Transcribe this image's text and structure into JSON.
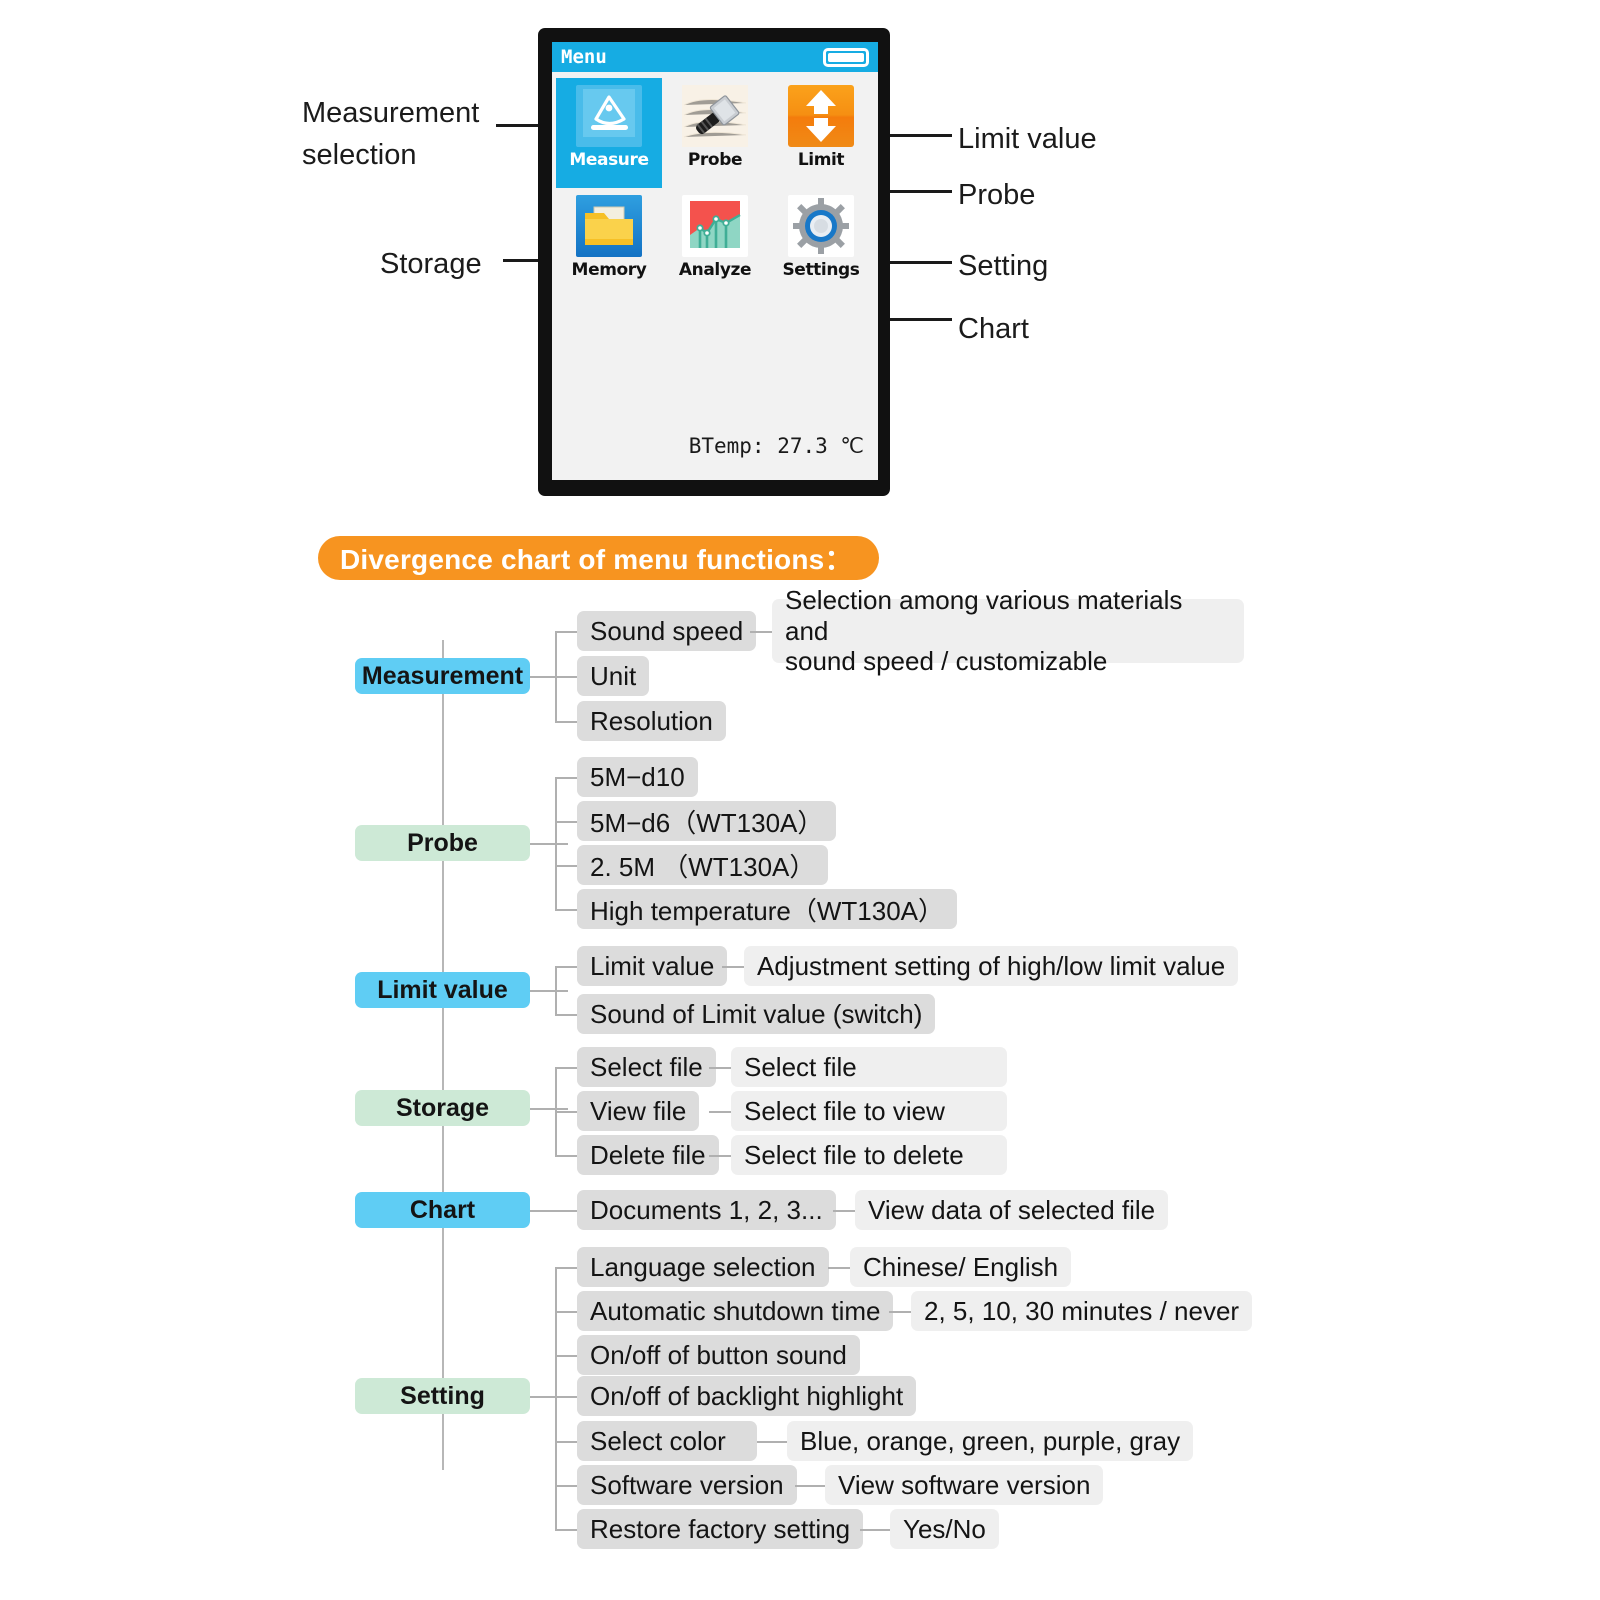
{
  "device": {
    "screen_title": "Menu",
    "battery_icon": "battery-full-icon",
    "status_text": "BTemp: 27.3 ℃",
    "tiles": [
      {
        "label": "Measure",
        "icon": "measure-icon",
        "selected": true
      },
      {
        "label": "Probe",
        "icon": "probe-icon",
        "selected": false
      },
      {
        "label": "Limit",
        "icon": "limit-icon",
        "selected": false
      },
      {
        "label": "Memory",
        "icon": "folder-icon",
        "selected": false
      },
      {
        "label": "Analyze",
        "icon": "chart-icon",
        "selected": false
      },
      {
        "label": "Settings",
        "icon": "gear-icon",
        "selected": false
      }
    ]
  },
  "callouts": {
    "left": [
      {
        "label": "Measurement\nselection",
        "line1": "Measurement",
        "line2": "selection"
      },
      {
        "label": "Storage",
        "line1": "Storage",
        "line2": ""
      }
    ],
    "right": [
      {
        "label": "Limit value"
      },
      {
        "label": "Probe"
      },
      {
        "label": "Setting"
      },
      {
        "label": "Chart"
      }
    ]
  },
  "banner": {
    "title": "Divergence chart of menu functions："
  },
  "colors": {
    "banner_orange": "#F79420",
    "root_blue": "#5FCDF4",
    "root_green": "#CDE9D6",
    "leaf_gray": "#DCDCDC",
    "leaf_light": "#EFEFEF",
    "screen_blue": "#16ACE3"
  },
  "tree": {
    "groups": [
      {
        "root": "Measurement",
        "root_color": "blue",
        "children": [
          {
            "label": "Sound speed",
            "detail": "Selection among various materials and\nsound speed / customizable"
          },
          {
            "label": "Unit",
            "detail": ""
          },
          {
            "label": "Resolution",
            "detail": ""
          }
        ]
      },
      {
        "root": "Probe",
        "root_color": "green",
        "children": [
          {
            "label": "5M−d10",
            "detail": ""
          },
          {
            "label": "5M−d6（WT130A）",
            "detail": ""
          },
          {
            "label": "2. 5M （WT130A）",
            "detail": ""
          },
          {
            "label": "High temperature（WT130A）",
            "detail": ""
          }
        ]
      },
      {
        "root": "Limit value",
        "root_color": "blue",
        "children": [
          {
            "label": "Limit value",
            "detail": "Adjustment setting of high/low limit value"
          },
          {
            "label": "Sound of Limit value (switch)",
            "detail": ""
          }
        ]
      },
      {
        "root": "Storage",
        "root_color": "green",
        "children": [
          {
            "label": "Select file",
            "detail": "Select file"
          },
          {
            "label": "View file",
            "detail": "Select file to view"
          },
          {
            "label": "Delete file",
            "detail": "Select file to delete"
          }
        ]
      },
      {
        "root": "Chart",
        "root_color": "blue",
        "children": [
          {
            "label": "Documents 1, 2, 3...",
            "detail": "View data of selected file"
          }
        ]
      },
      {
        "root": "Setting",
        "root_color": "green",
        "children": [
          {
            "label": "Language selection",
            "detail": "Chinese/ English"
          },
          {
            "label": "Automatic shutdown time",
            "detail": "2, 5, 10, 30 minutes / never"
          },
          {
            "label": "On/off of button sound",
            "detail": ""
          },
          {
            "label": "On/off of backlight highlight",
            "detail": ""
          },
          {
            "label": "Select color",
            "detail": "Blue, orange, green, purple, gray"
          },
          {
            "label": "Software version",
            "detail": "View software version"
          },
          {
            "label": "Restore factory setting",
            "detail": "Yes/No"
          }
        ]
      }
    ]
  }
}
